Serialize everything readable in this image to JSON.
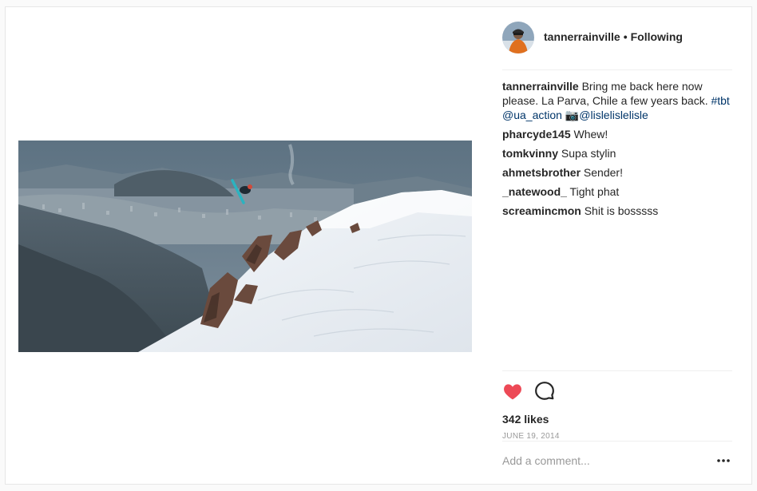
{
  "post": {
    "username": "tannerrainville",
    "separator": "•",
    "follow_status": "Following",
    "caption": {
      "username": "tannerrainville",
      "text": "Bring me back here now please. La Parva, Chile a few years back.",
      "hashtag": "#tbt",
      "mention1": "@ua_action",
      "camera_emoji": "📷",
      "mention2": "@lislelislelisle"
    },
    "comments": [
      {
        "user": "pharcyde145",
        "text": "Whew!"
      },
      {
        "user": "tomkvinny",
        "text": "Supa stylin"
      },
      {
        "user": "ahmetsbrother",
        "text": "Sender!"
      },
      {
        "user": "_natewood_",
        "text": "Tight phat"
      },
      {
        "user": "screamincmon",
        "text": "Shit is bosssss"
      }
    ],
    "likes": "342 likes",
    "date": "JUNE 19, 2014",
    "liked": true
  },
  "add_comment": {
    "placeholder": "Add a comment...",
    "value": ""
  },
  "icons": {
    "like": "heart-icon",
    "comment": "comment-bubble-icon",
    "more": "more-options-icon"
  },
  "colors": {
    "heart": "#ed4956",
    "text": "#262626",
    "link": "#003569",
    "muted": "#999999",
    "divider": "#efefef"
  }
}
